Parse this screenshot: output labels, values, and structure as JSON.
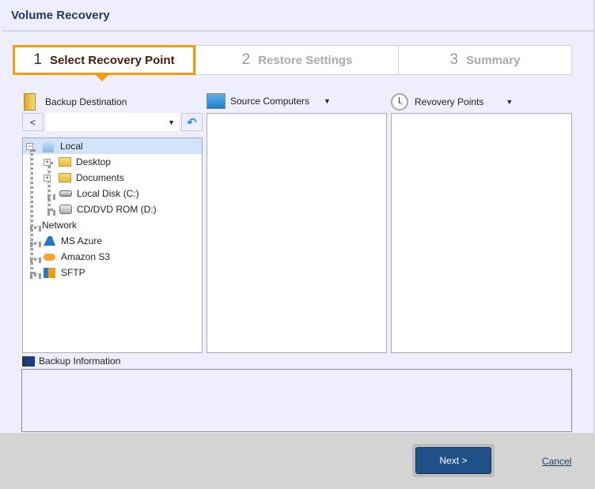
{
  "window": {
    "title": "Volume Recovery"
  },
  "steps": [
    {
      "number": "1",
      "label": "Select Recovery Point",
      "active": true
    },
    {
      "number": "2",
      "label": "Restore Settings",
      "active": false
    },
    {
      "number": "3",
      "label": "Summary",
      "active": false
    }
  ],
  "panels": {
    "backup_destination": {
      "label": "Backup Destination",
      "back_label": "<",
      "path_value": ""
    },
    "source_computers": {
      "label": "Source Computers"
    },
    "recovery_points": {
      "label": "Revovery Points"
    }
  },
  "tree": [
    {
      "label": "Local",
      "icon": "home-icon",
      "selected": true,
      "expanded": true
    },
    {
      "label": "Desktop",
      "icon": "folder-icon"
    },
    {
      "label": "Documents",
      "icon": "folder-icon"
    },
    {
      "label": "Local Disk (C:)",
      "icon": "hard-disk-icon"
    },
    {
      "label": "CD/DVD ROM (D:)",
      "icon": "cd-drive-icon"
    },
    {
      "label": "Network",
      "icon": ""
    },
    {
      "label": "MS Azure",
      "icon": "azure-icon"
    },
    {
      "label": "Amazon S3",
      "icon": "aws-icon"
    },
    {
      "label": "SFTP",
      "icon": "sftp-icon"
    }
  ],
  "backup_info": {
    "label": "Backup Information"
  },
  "footer": {
    "next_label": "Next >",
    "cancel_label": "Cancel"
  },
  "colors": {
    "accent": "#f39c12",
    "primary_button": "#1f5088",
    "background": "#eeeefc"
  }
}
